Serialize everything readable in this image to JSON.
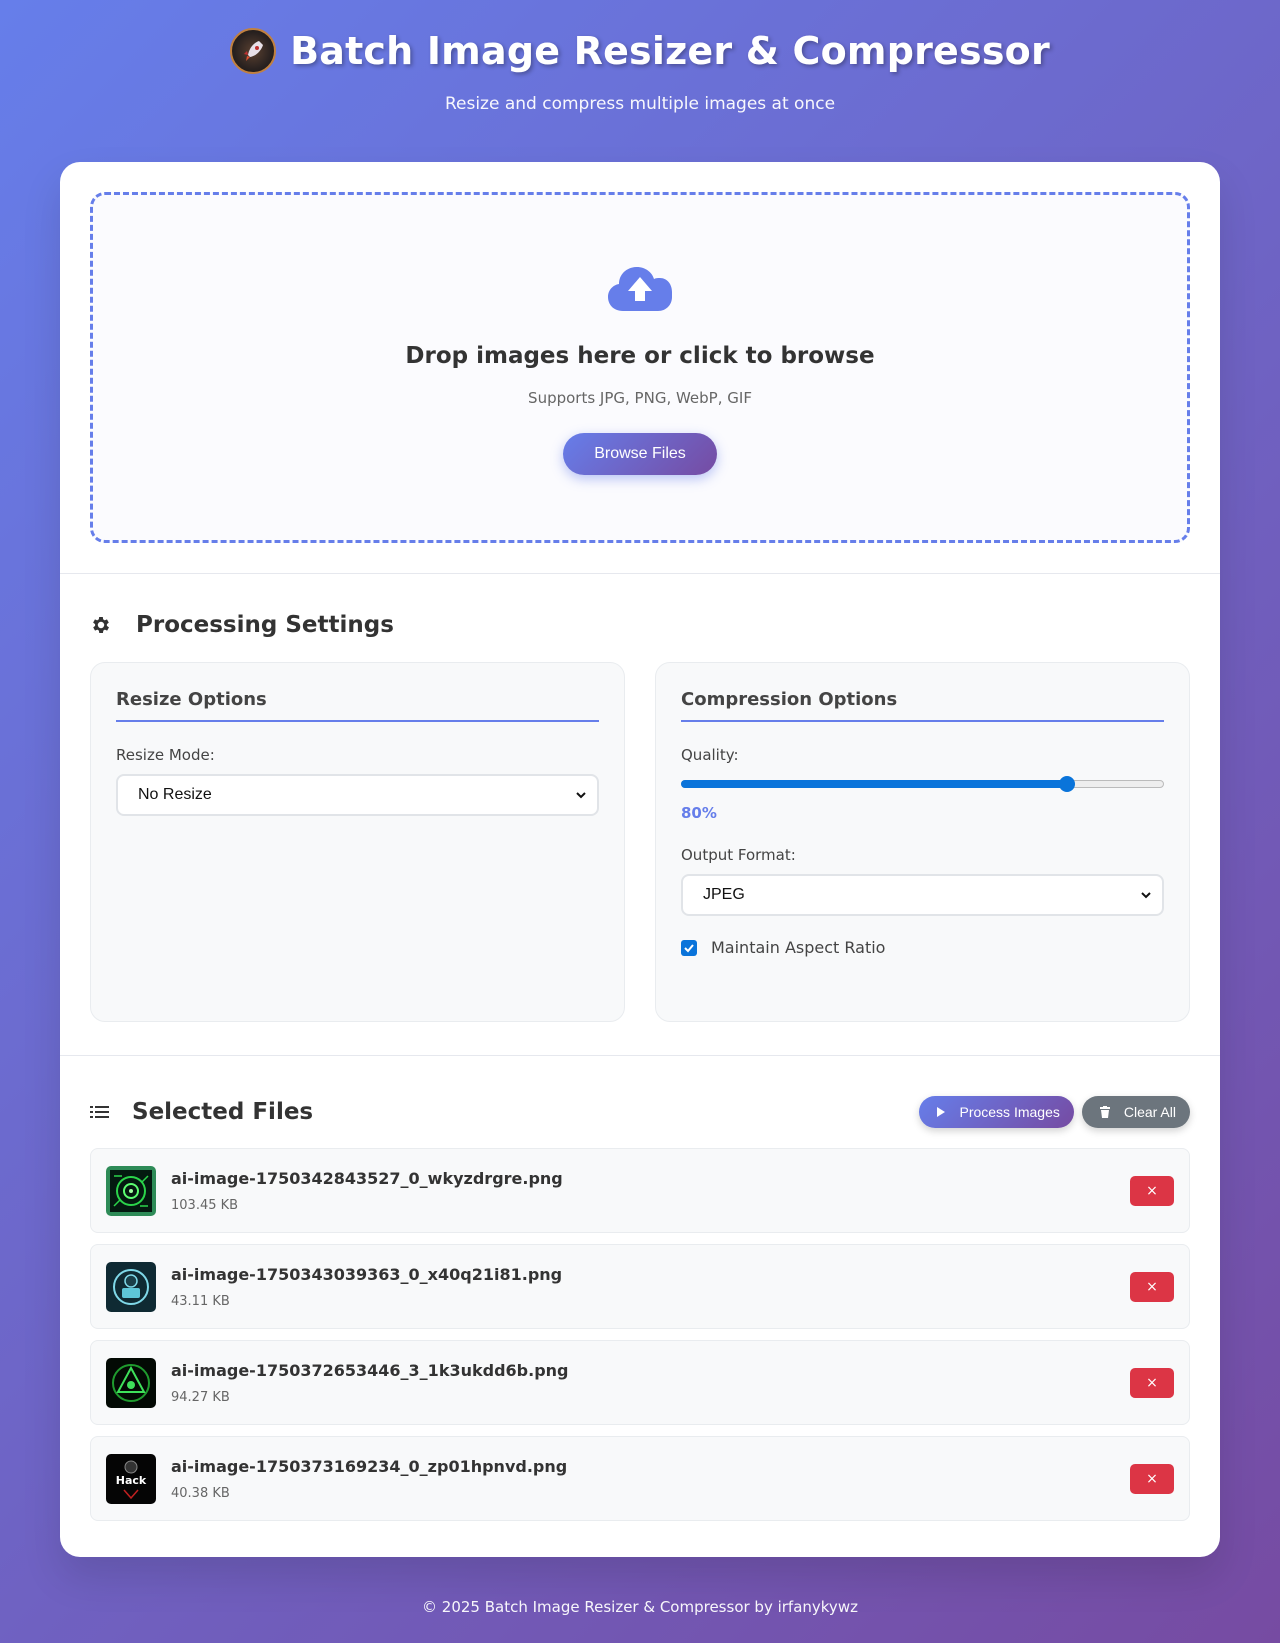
{
  "header": {
    "title": "Batch Image Resizer & Compressor",
    "subtitle": "Resize and compress multiple images at once",
    "logo_icon": "rocket-icon"
  },
  "upload": {
    "icon": "cloud-upload-icon",
    "title": "Drop images here or click to browse",
    "supported": "Supports JPG, PNG, WebP, GIF",
    "browse_label": "Browse Files"
  },
  "settings": {
    "title": "Processing Settings",
    "icon": "gear-icon",
    "resize": {
      "title": "Resize Options",
      "mode_label": "Resize Mode:",
      "mode_value": "No Resize"
    },
    "compression": {
      "title": "Compression Options",
      "quality_label": "Quality:",
      "quality_value": 80,
      "quality_display": "80%",
      "format_label": "Output Format:",
      "format_value": "JPEG",
      "aspect_label": "Maintain Aspect Ratio",
      "aspect_checked": true
    }
  },
  "files": {
    "title": "Selected Files",
    "icon": "list-icon",
    "process_label": "Process Images",
    "clear_label": "Clear All",
    "items": [
      {
        "name": "ai-image-1750342843527_0_wkyzdrgre.png",
        "size": "103.45 KB",
        "remove": "×"
      },
      {
        "name": "ai-image-1750343039363_0_x40q21i81.png",
        "size": "43.11 KB",
        "remove": "×"
      },
      {
        "name": "ai-image-1750372653446_3_1k3ukdd6b.png",
        "size": "94.27 KB",
        "remove": "×"
      },
      {
        "name": "ai-image-1750373169234_0_zp01hpnvd.png",
        "size": "40.38 KB",
        "remove": "×",
        "thumb_text": "Hack"
      }
    ]
  },
  "footer": {
    "text": "© 2025 Batch Image Resizer & Compressor by irfanykywz"
  },
  "colors": {
    "gradient_start": "#667eea",
    "gradient_end": "#764ba2",
    "danger": "#dc3545",
    "secondary": "#6c757d",
    "slider_blue": "#0a74da"
  }
}
